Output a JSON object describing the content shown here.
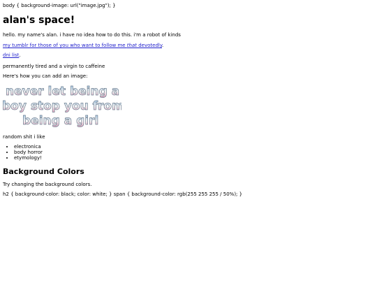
{
  "css_top": "body { background-image: url(\"image.jpg\"); }",
  "title": "alan's space!",
  "intro": "hello. my name's alan. i have no idea how to do this. i'm a robot of kinds",
  "tumblr": {
    "link_pre": "my tumblr for those of you who want to follow me ",
    "link_em": "that",
    "link_post": " devotedly",
    "trail": "."
  },
  "dni": {
    "link": "dni list",
    "trail": "."
  },
  "tired": "permanently tired and a virgin to caffeine",
  "image_intro": "Here's how you can add an image:",
  "banner": {
    "lines": [
      "never let being a",
      "boy stop you from",
      "being a girl"
    ],
    "colors": {
      "top": "#9ec6e6",
      "mid": "#f3f3f3",
      "bottom": "#e59bb9",
      "outline": "#6d7d8f"
    }
  },
  "random_label": "random shit i like",
  "likes": [
    "electronica",
    "body horror",
    "etymology!"
  ],
  "bg_heading": "Background Colors",
  "bg_text": "Try changing the background colors.",
  "css_bottom": "h2 { background-color: black; color: white; } span { background-color: rgb(255 255 255 / 50%); }"
}
